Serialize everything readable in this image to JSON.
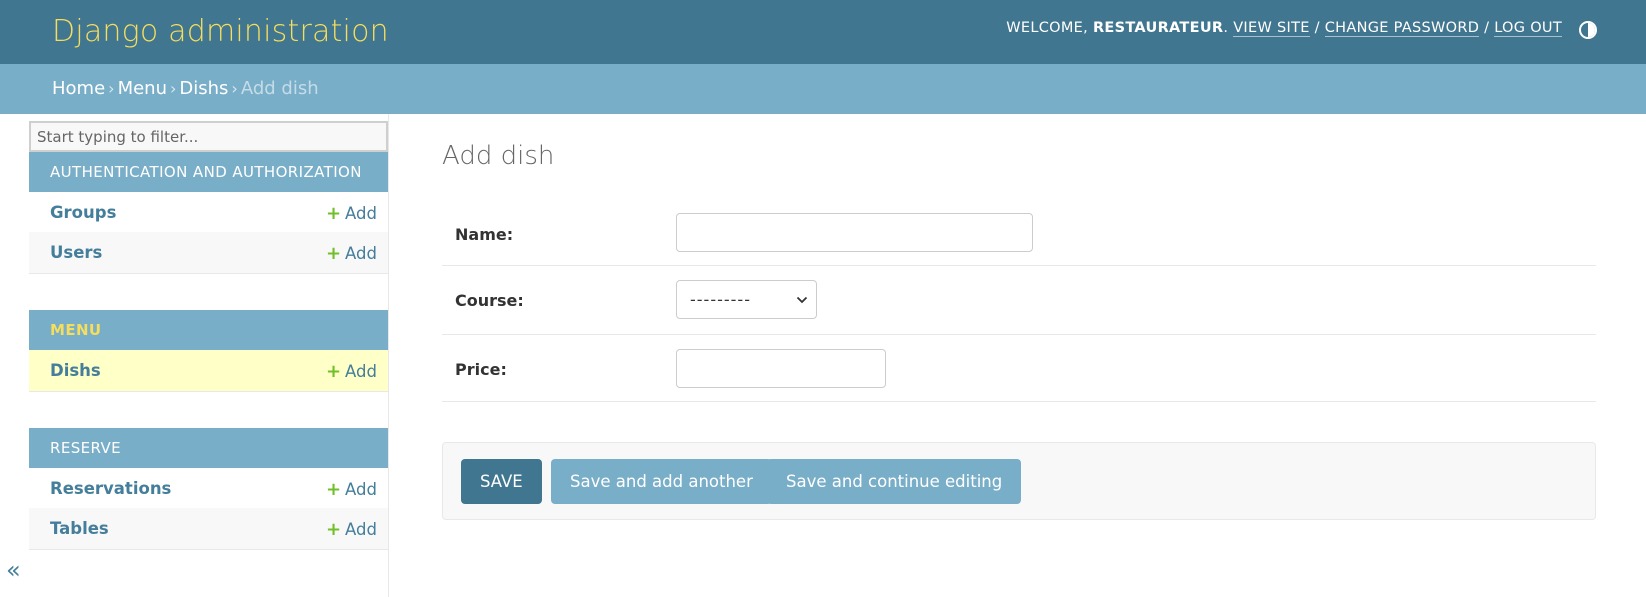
{
  "header": {
    "branding": "Django administration",
    "welcome_prefix": "Welcome, ",
    "username": "restaurateur",
    "view_site": "View site",
    "change_password": "Change password",
    "log_out": "Log out",
    "theme_toggle_icon": "half-circle-contrast-icon"
  },
  "breadcrumbs": {
    "items": [
      "Home",
      "Menu",
      "Dishs"
    ],
    "current": "Add dish",
    "separator": "›"
  },
  "sidebar": {
    "filter_placeholder": "Start typing to filter...",
    "apps": [
      {
        "caption": "Authentication and Authorization",
        "models": [
          {
            "name": "Groups",
            "add": "Add"
          },
          {
            "name": "Users",
            "add": "Add"
          }
        ]
      },
      {
        "caption": "Menu",
        "models": [
          {
            "name": "Dishs",
            "add": "Add"
          }
        ]
      },
      {
        "caption": "Reserve",
        "models": [
          {
            "name": "Reservations",
            "add": "Add"
          },
          {
            "name": "Tables",
            "add": "Add"
          }
        ]
      }
    ],
    "add_icon": "+",
    "collapse_icon": "«"
  },
  "content": {
    "title": "Add dish",
    "fields": {
      "name_label": "Name:",
      "name_value": "",
      "course_label": "Course:",
      "course_value": "---------",
      "price_label": "Price:",
      "price_value": ""
    },
    "buttons": {
      "save": "SAVE",
      "save_add_another": "Save and add another",
      "save_continue": "Save and continue editing"
    }
  },
  "colors": {
    "header_bg": "#417690",
    "breadcrumbs_bg": "#79aec8",
    "branding": "#f5dd5d",
    "link": "#447e9b",
    "add_plus": "#70bf2b",
    "selected_row": "#ffffc8"
  }
}
